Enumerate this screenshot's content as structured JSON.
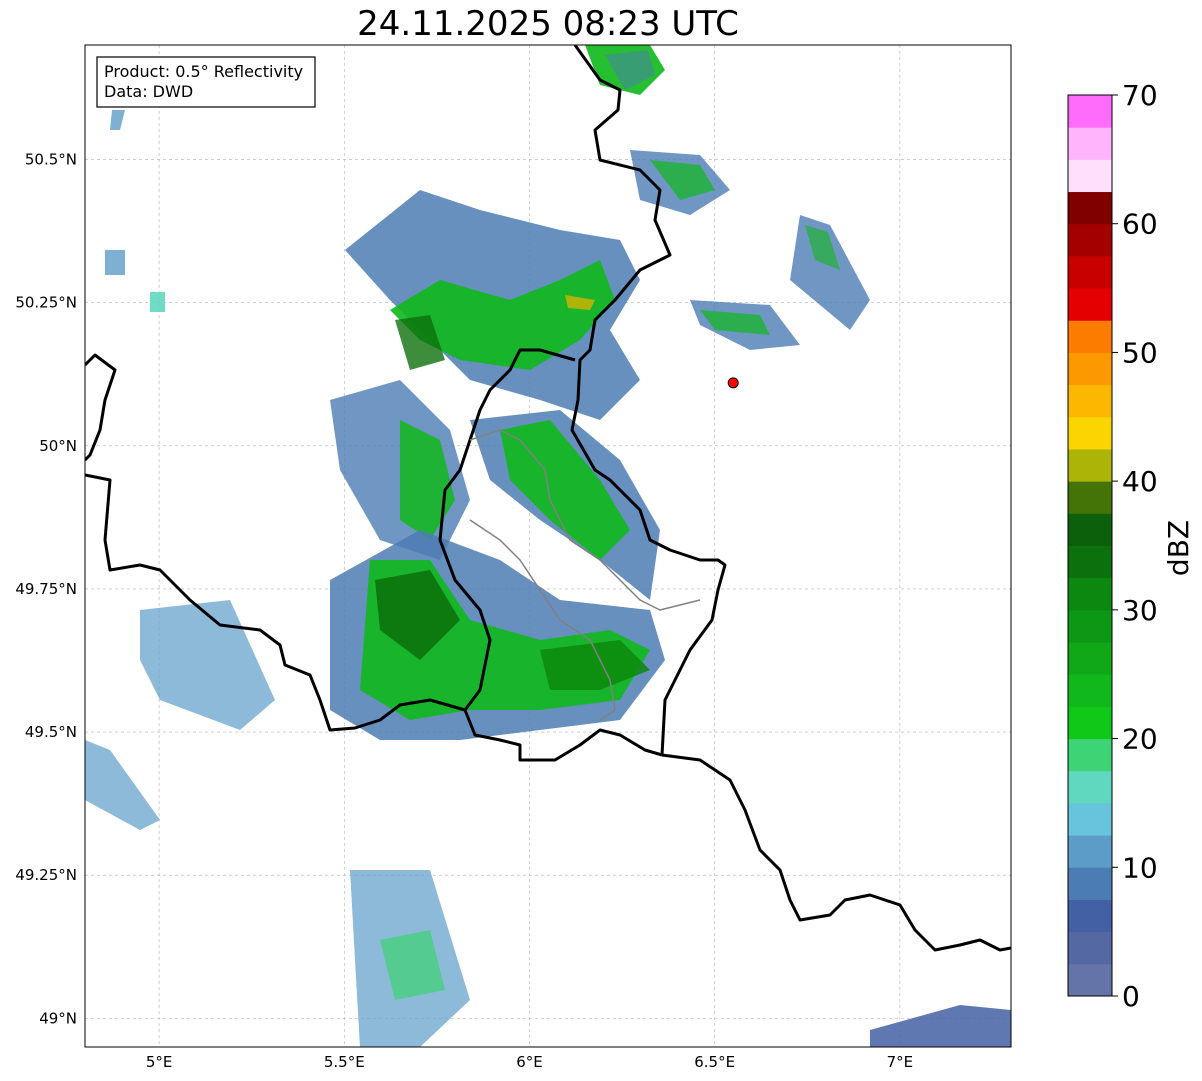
{
  "title": "24.11.2025 08:23 UTC",
  "info_box": {
    "product_line": "Product: 0.5° Reflectivity",
    "data_line": "Data: DWD"
  },
  "map": {
    "lon_range": [
      4.8,
      7.3
    ],
    "lat_range": [
      48.95,
      50.7
    ],
    "lon_ticks": [
      "5°E",
      "5.5°E",
      "6°E",
      "6.5°E",
      "7°E"
    ],
    "lat_ticks": [
      "50.5°N",
      "50.25°N",
      "50°N",
      "49.75°N",
      "49.5°N",
      "49.25°N",
      "49°N"
    ],
    "gridlines": true,
    "radar_site_marker": {
      "lon": 6.55,
      "lat": 50.11,
      "color": "#ff0000"
    }
  },
  "colorbar": {
    "label": "dBZ",
    "ticks": [
      "0",
      "10",
      "20",
      "30",
      "40",
      "50",
      "60",
      "70"
    ],
    "range": [
      0,
      70
    ],
    "step": 2.5,
    "colors": [
      "#6474a8",
      "#5468a4",
      "#4460a4",
      "#4c7cb4",
      "#5c9cc8",
      "#68c4dc",
      "#60d8c0",
      "#3cd474",
      "#10c818",
      "#10b81c",
      "#10a818",
      "#0c9814",
      "#0c8810",
      "#0c700c",
      "#0c600c",
      "#447408",
      "#acb408",
      "#fcd400",
      "#fcb800",
      "#fc9800",
      "#fc7c00",
      "#e40000",
      "#c80000",
      "#a40000",
      "#800000",
      "#ffe0fc",
      "#ffb4fc",
      "#ff6cfc",
      "#e838ec"
    ]
  }
}
